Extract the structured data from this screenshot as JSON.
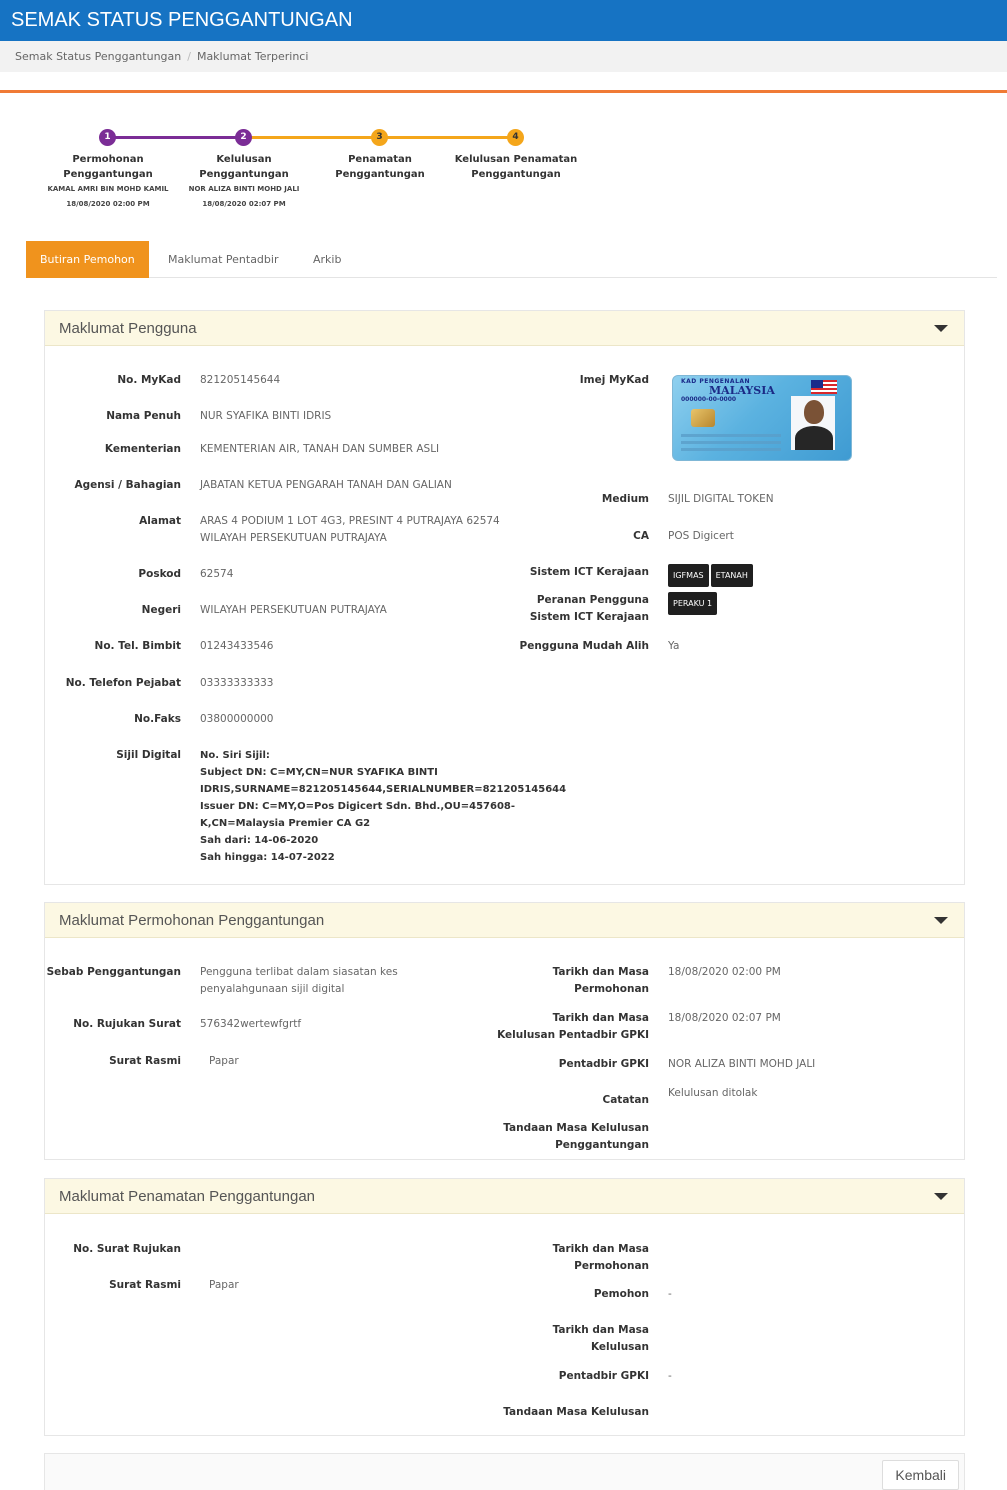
{
  "header": {
    "title": "SEMAK STATUS PENGGANTUNGAN"
  },
  "breadcrumb": {
    "items": [
      "Semak Status Penggantungan",
      "Maklumat Terperinci"
    ],
    "separator": "/"
  },
  "stepper": {
    "steps": [
      {
        "num": "1",
        "label_lines": [
          "Permohonan",
          "Penggantungan"
        ],
        "sub_lines": [
          "KAMAL AMRI BIN MOHD KAMIL",
          "18/08/2020 02:00 PM"
        ],
        "status": "done"
      },
      {
        "num": "2",
        "label_lines": [
          "Kelulusan Penggantungan"
        ],
        "sub_lines": [
          "NOR ALIZA BINTI MOHD JALI",
          "18/08/2020 02:07 PM"
        ],
        "status": "done"
      },
      {
        "num": "3",
        "label_lines": [
          "Penamatan",
          "Penggantungan"
        ],
        "sub_lines": [],
        "status": "pending"
      },
      {
        "num": "4",
        "label_lines": [
          "Kelulusan Penamatan",
          "Penggantungan"
        ],
        "sub_lines": [],
        "status": "pending"
      }
    ],
    "colors": {
      "done": "#7b2d96",
      "pending": "#f4a61b"
    }
  },
  "tabs": [
    "Butiran Pemohon",
    "Maklumat Pentadbir",
    "Arkib"
  ],
  "pengguna": {
    "title": "Maklumat Pengguna",
    "left": [
      {
        "label": "No. MyKad",
        "value": "821205145644"
      },
      {
        "label": "Nama Penuh",
        "value": "NUR SYAFIKA BINTI IDRIS"
      },
      {
        "label": "Kementerian",
        "value": "KEMENTERIAN AIR, TANAH DAN SUMBER ASLI"
      },
      {
        "label": "Agensi / Bahagian",
        "value": "JABATAN KETUA PENGARAH TANAH DAN GALIAN"
      },
      {
        "label": "Alamat",
        "value_lines": [
          "ARAS 4 PODIUM 1 LOT 4G3, PRESINT 4 PUTRAJAYA 62574",
          "WILAYAH PERSEKUTUAN PUTRAJAYA"
        ]
      },
      {
        "label": "Poskod",
        "value": "62574"
      },
      {
        "label": "Negeri",
        "value": "WILAYAH PERSEKUTUAN PUTRAJAYA"
      },
      {
        "label": "No. Tel. Bimbit",
        "value": "01243433546"
      },
      {
        "label": "No. Telefon Pejabat",
        "value": "03333333333"
      },
      {
        "label": "No.Faks",
        "value": "03800000000"
      }
    ],
    "sijil": {
      "label": "Sijil Digital",
      "lines": [
        "No. Siri Sijil:",
        "Subject DN: C=MY,CN=NUR SYAFIKA BINTI",
        "IDRIS,SURNAME=821205145644,SERIALNUMBER=821205145644",
        "Issuer DN: C=MY,O=Pos Digicert Sdn. Bhd.,OU=457608-",
        "K,CN=Malaysia Premier CA G2",
        "Sah dari: 14-06-2020",
        "Sah hingga: 14-07-2022"
      ]
    },
    "right": {
      "imej_label": "Imej MyKad",
      "card": {
        "header": "KAD PENGENALAN",
        "country": "MALAYSIA",
        "number": "000000-00-0000"
      },
      "medium_label": "Medium",
      "medium": "SIJIL DIGITAL TOKEN",
      "ca_label": "CA",
      "ca": "POS Digicert",
      "sistem_label": "Sistem ICT Kerajaan",
      "sistem_badges": [
        "IGFMAS",
        "ETANAH"
      ],
      "peranan_label_lines": [
        "Peranan Pengguna",
        "Sistem ICT Kerajaan"
      ],
      "peranan_badges": [
        "PERAKU 1"
      ],
      "mudah_alih_label": "Pengguna Mudah Alih",
      "mudah_alih": "Ya"
    }
  },
  "permohonan": {
    "title": "Maklumat Permohonan Penggantungan",
    "sebab_label": "Sebab Penggantungan",
    "sebab_lines": [
      "Pengguna terlibat dalam siasatan kes",
      "penyalahgunaan sijil digital"
    ],
    "rujukan_label": "No. Rujukan Surat",
    "rujukan": "576342wertewfgrtf",
    "surat_label": "Surat Rasmi",
    "surat": "Papar",
    "tarikh_mohon_label_lines": [
      "Tarikh dan Masa",
      "Permohonan"
    ],
    "tarikh_mohon": "18/08/2020 02:00 PM",
    "tarikh_lulus_label_lines": [
      "Tarikh dan Masa",
      "Kelulusan Pentadbir GPKI"
    ],
    "tarikh_lulus": "18/08/2020 02:07 PM",
    "pentadbir_label": "Pentadbir GPKI",
    "pentadbir": "NOR ALIZA BINTI MOHD JALI",
    "catatan_label": "Catatan",
    "catatan": "Kelulusan ditolak",
    "tandaan_label_lines": [
      "Tandaan Masa Kelulusan",
      "Penggantungan"
    ]
  },
  "penamatan": {
    "title": "Maklumat Penamatan Penggantungan",
    "rujukan_label": "No. Surat Rujukan",
    "surat_label": "Surat Rasmi",
    "surat": "Papar",
    "tarikh_mohon_label_lines": [
      "Tarikh dan Masa",
      "Permohonan"
    ],
    "pemohon_label": "Pemohon",
    "pemohon": "-",
    "tarikh_lulus_label_lines": [
      "Tarikh dan Masa",
      "Kelulusan"
    ],
    "pentadbir_label": "Pentadbir GPKI",
    "pentadbir": "-",
    "tandaan_label": "Tandaan Masa Kelulusan"
  },
  "footer": {
    "back_label": "Kembali"
  },
  "colors": {
    "header": "#1673c3",
    "accent": "#f0931d",
    "panel_head": "#fcf8e3"
  }
}
